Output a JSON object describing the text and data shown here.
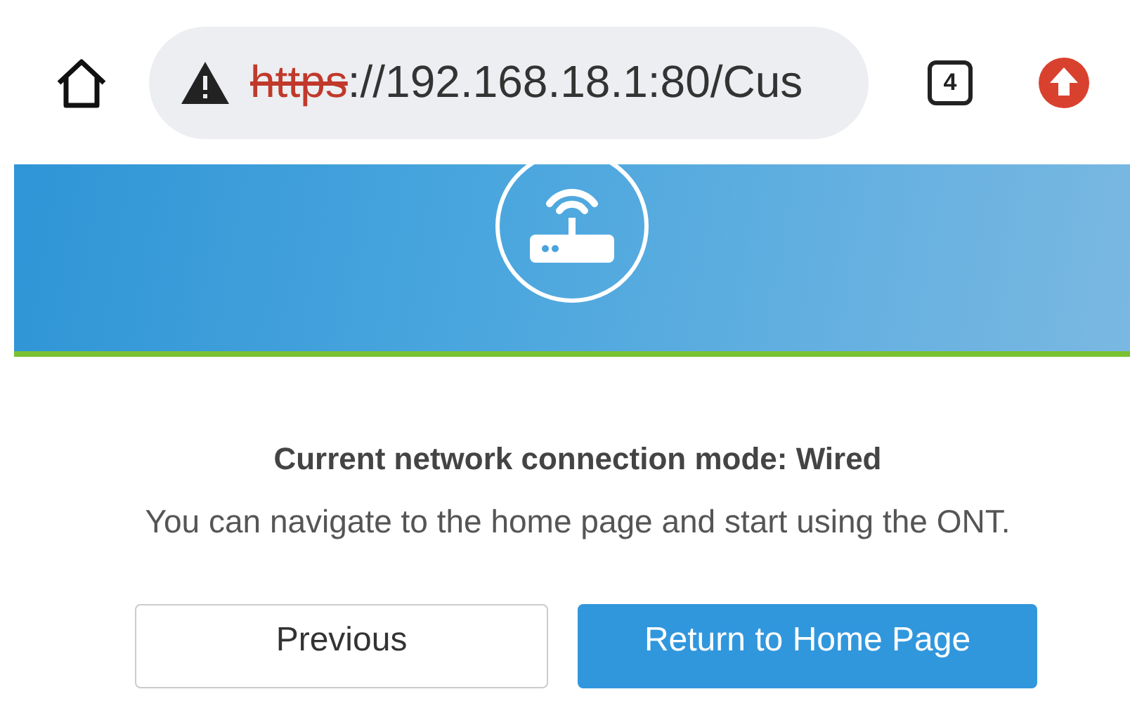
{
  "browser_bar": {
    "url": {
      "scheme": "https",
      "rest": "://192.168.18.1:80/Cus",
      "insecure": true
    },
    "tab_count": "4"
  },
  "banner": {
    "kind": "router"
  },
  "message": {
    "title": "Current network connection mode: Wired",
    "text": "You can navigate to the home page and start using the ONT."
  },
  "buttons": [
    {
      "label": "Previous",
      "kind": "secondary"
    },
    {
      "label": "Return to Home Page",
      "kind": "primary"
    }
  ]
}
